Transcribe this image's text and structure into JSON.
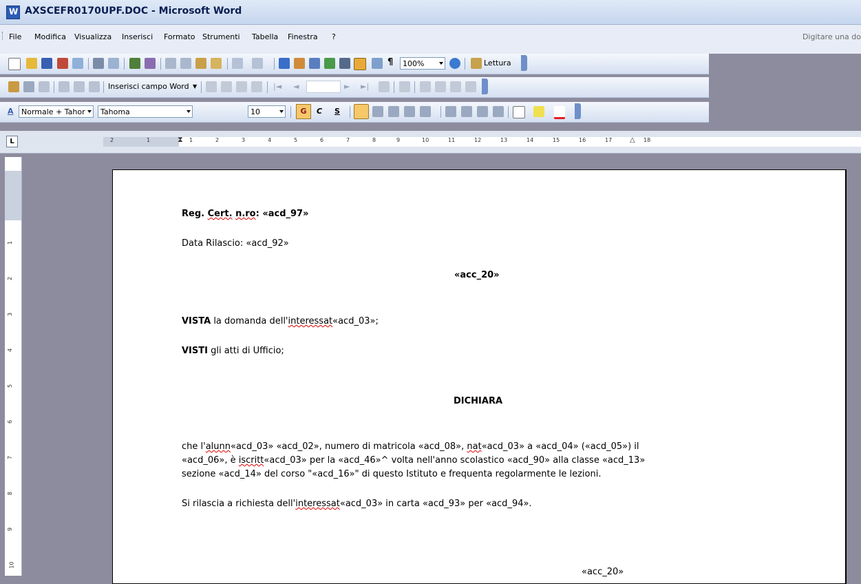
{
  "window": {
    "title": "AXSCEFR0170UPF.DOC - Microsoft Word"
  },
  "menu": {
    "items": [
      "File",
      "Modifica",
      "Visualizza",
      "Inserisci",
      "Formato",
      "Strumenti",
      "Tabella",
      "Finestra",
      "?"
    ],
    "help_hint": "Digitare una do"
  },
  "toolbar_standard": {
    "zoom": "100%",
    "reading_label": "Lettura"
  },
  "toolbar_mailmerge": {
    "insert_field_label": "Inserisci campo Word"
  },
  "toolbar_formatting": {
    "style": "Normale + Tahor",
    "font": "Tahoma",
    "size": "10",
    "bold": "G",
    "italic": "C",
    "underline": "S"
  },
  "ruler": {
    "tab_button": "L",
    "h_labels": [
      "2",
      "1",
      "1",
      "2",
      "3",
      "4",
      "5",
      "6",
      "7",
      "8",
      "9",
      "10",
      "11",
      "12",
      "13",
      "14",
      "15",
      "16",
      "17",
      "18"
    ],
    "v_labels": [
      "1",
      "2",
      "3",
      "4",
      "5",
      "6",
      "7",
      "8",
      "9",
      "10"
    ]
  },
  "document": {
    "reg_prefix": "Reg. ",
    "reg_cert": "Cert.",
    "reg_nro": "n.ro",
    "reg_suffix": ": «acd_97»",
    "data_rilascio": "Data Rilascio: «acd_92»",
    "heading1": "«acc_20»",
    "vista_bold": "VISTA",
    "vista_rest1": " la domanda dell'",
    "vista_squig": "interessat",
    "vista_rest2": "«acd_03»;",
    "visti_bold": "VISTI",
    "visti_rest": " gli atti di Ufficio;",
    "dichiara": "DICHIARA",
    "p1_a": "che l'",
    "p1_b": "alunn",
    "p1_c": "«acd_03» «acd_02», numero di matricola «acd_08», ",
    "p1_d": "nat",
    "p1_e": "«acd_03» a «acd_04» («acd_05») il",
    "p2_a": "«acd_06», è ",
    "p2_b": "iscritt",
    "p2_c": "«acd_03» per la «acd_46»^ volta nell'anno scolastico «acd_90» alla classe «acd_13»",
    "p3": "sezione «acd_14» del corso \"«acd_16»\" di questo Istituto e frequenta regolarmente le lezioni.",
    "p4_a": "Si rilascia a richiesta dell'",
    "p4_b": "interessat",
    "p4_c": "«acd_03» in carta «acd_93» per «acd_94».",
    "footer": "«acc_20»"
  }
}
